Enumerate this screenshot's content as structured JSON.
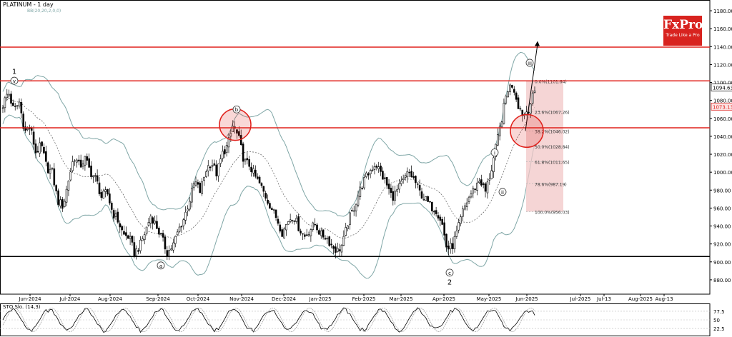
{
  "chart_title": "PLATINUM - 1 day",
  "indicator_label": "BB(20,20,2,0,0)",
  "oscillator_label": "STO Slo. (14,3)",
  "logo": {
    "brand": "FxPro",
    "tagline": "Trade Like a Pro"
  },
  "colors": {
    "bull": "#15a53a",
    "bear": "#d8231f",
    "candle": "#000000",
    "band": "#7fa6a6",
    "level": "#e0201b",
    "support": "#000000",
    "fib_zone": "#f2c7c7",
    "logo_bg": "#d8231f"
  },
  "chart_data": {
    "type": "candlestick",
    "title": "PLATINUM - 1 day",
    "ylim": [
      864,
      1192
    ],
    "y_ticks": [
      "1180.00",
      "1160.00",
      "1140.00",
      "1120.00",
      "1100.00",
      "1080.00",
      "1060.00",
      "1040.00",
      "1020.00",
      "1000.00",
      "980.00",
      "960.00",
      "940.00",
      "920.00",
      "900.00",
      "880.00"
    ],
    "x_ticks": [
      "Jun-2024",
      "Jul-2024",
      "Aug-2024",
      "Sep-2024",
      "Oct-2024",
      "Nov-2024",
      "Dec-2024",
      "Jan-2025",
      "Feb-2025",
      "Mar-2025",
      "Apr-2025",
      "May-2025",
      "Jun-2025",
      "Jul-2025",
      "Jul-13",
      "Aug-2025",
      "Aug-13"
    ],
    "price_tags": [
      "1094.63",
      "1073.13"
    ],
    "horizontal_levels": [
      1139.5,
      1101.8,
      1049.5
    ],
    "support_level": 906,
    "fibonacci": [
      {
        "label": "0.0%(1101.64)",
        "price": 1101.64
      },
      {
        "label": "23.6%(1067.26)",
        "price": 1067.26
      },
      {
        "label": "38.2%(1046.02)",
        "price": 1046.02
      },
      {
        "label": "50.0%(1028.84)",
        "price": 1028.84
      },
      {
        "label": "61.8%(1011.65)",
        "price": 1011.65
      },
      {
        "label": "78.6%(987.19)",
        "price": 987.19
      },
      {
        "label": "100.0%(956.03)",
        "price": 956.03
      }
    ],
    "wave_labels": [
      "1",
      "v",
      "a",
      "b",
      "c",
      "2",
      "i",
      "ii",
      "iii"
    ],
    "series_anchors": [
      1075,
      1090,
      1068,
      1078,
      1045,
      1050,
      1022,
      1030,
      1005,
      1000,
      968,
      962,
      992,
      1018,
      1006,
      1015,
      1000,
      992,
      972,
      978,
      955,
      946,
      930,
      928,
      910,
      918,
      934,
      952,
      940,
      926,
      910,
      918,
      935,
      948,
      968,
      990,
      978,
      1002,
      1012,
      998,
      1020,
      1030,
      1052,
      1038,
      1012,
      1008,
      995,
      985,
      972,
      960,
      948,
      932,
      946,
      952,
      938,
      928,
      936,
      942,
      930,
      928,
      918,
      912,
      920,
      946,
      960,
      978,
      992,
      1002,
      1010,
      998,
      986,
      972,
      980,
      990,
      1000,
      992,
      978,
      970,
      962,
      958,
      946,
      914,
      918,
      936,
      958,
      972,
      982,
      992,
      978,
      1000,
      1030,
      1060,
      1092,
      1098,
      1075,
      1063,
      1073,
      1090
    ]
  },
  "oscillator": {
    "ticks": [
      "77.5",
      "50",
      "22.5"
    ]
  }
}
